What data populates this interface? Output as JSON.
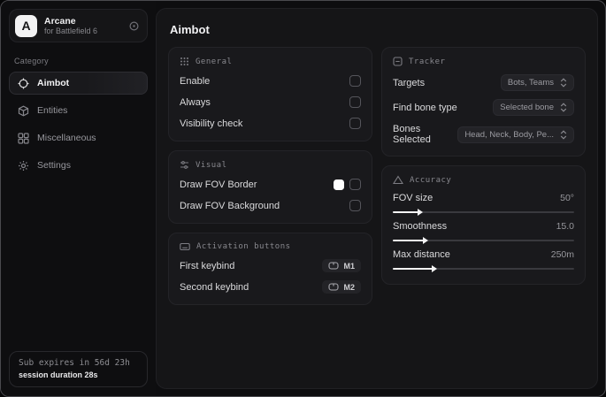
{
  "sidebar": {
    "logo_letter": "A",
    "app_name": "Arcane",
    "app_subtitle": "for Battlefield 6",
    "category_label": "Category",
    "items": [
      {
        "label": "Aimbot",
        "icon": "crosshair-icon",
        "active": true
      },
      {
        "label": "Entities",
        "icon": "entities-icon",
        "active": false
      },
      {
        "label": "Miscellaneous",
        "icon": "layout-grid-icon",
        "active": false
      },
      {
        "label": "Settings",
        "icon": "gear-icon",
        "active": false
      }
    ],
    "footer": {
      "line1": "Sub expires in 56d 23h",
      "line2": "session duration 28s"
    }
  },
  "main": {
    "title": "Aimbot",
    "general": {
      "title": "General",
      "rows": [
        {
          "label": "Enable",
          "checked": false
        },
        {
          "label": "Always",
          "checked": false
        },
        {
          "label": "Visibility check",
          "checked": false
        }
      ]
    },
    "visual": {
      "title": "Visual",
      "rows": [
        {
          "label": "Draw FOV Border",
          "swatch_color": "#ffffff",
          "checked": false
        },
        {
          "label": "Draw FOV Background",
          "checked": false
        }
      ]
    },
    "activation": {
      "title": "Activation buttons",
      "rows": [
        {
          "label": "First keybind",
          "key": "M1"
        },
        {
          "label": "Second keybind",
          "key": "M2"
        }
      ]
    },
    "tracker": {
      "title": "Tracker",
      "rows": [
        {
          "label": "Targets",
          "value": "Bots, Teams"
        },
        {
          "label": "Find bone type",
          "value": "Selected bone"
        },
        {
          "label": "Bones Selected",
          "value": "Head, Neck, Body, Pe..."
        }
      ]
    },
    "accuracy": {
      "title": "Accuracy",
      "sliders": [
        {
          "label": "FOV size",
          "value": "50°",
          "percent": 14
        },
        {
          "label": "Smoothness",
          "value": "15.0",
          "percent": 17
        },
        {
          "label": "Max distance",
          "value": "250m",
          "percent": 22
        }
      ]
    }
  },
  "icons": {
    "brand": "refresh-icon",
    "general_header": "grip-dots-icon",
    "visual_header": "sliders-icon",
    "activation_header": "keyboard-icon",
    "tracker_header": "minus-square-icon",
    "accuracy_header": "triangle-icon",
    "dropdown": "chevrons-up-down-icon",
    "keybind": "mouse-icon"
  },
  "colors": {
    "accent_swatch": "#ffffff",
    "panel_bg": "#151517",
    "card_bg": "#19191c"
  }
}
